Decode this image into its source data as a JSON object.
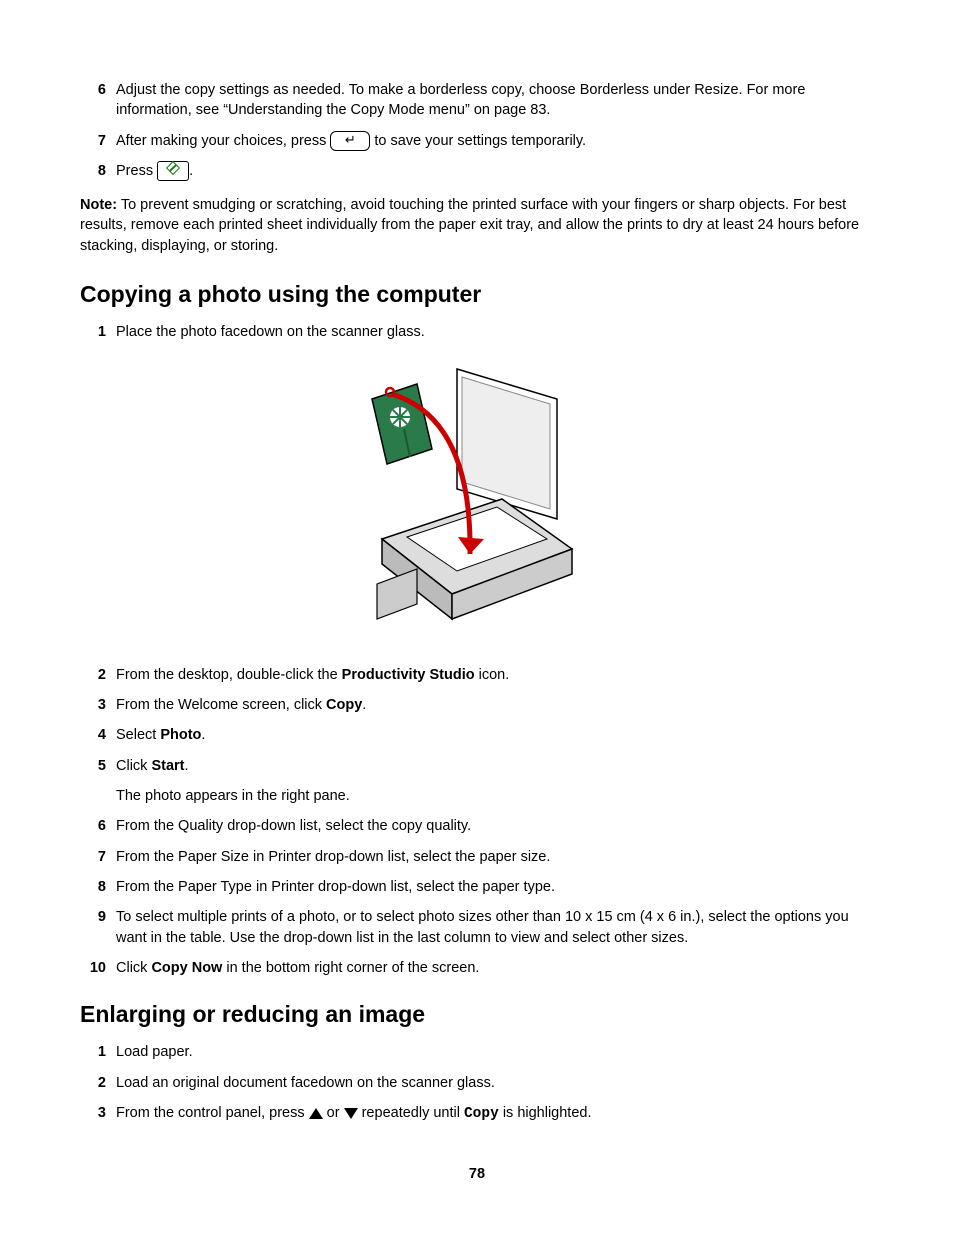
{
  "topSteps": {
    "s6": "Adjust the copy settings as needed. To make a borderless copy, choose Borderless under Resize. For more information, see “Understanding the Copy Mode menu” on page 83.",
    "s7_a": "After making your choices, press ",
    "s7_b": " to save your settings temporarily.",
    "s8_a": "Press ",
    "s8_b": "."
  },
  "note": {
    "label": "Note:",
    "text": " To prevent smudging or scratching, avoid touching the printed surface with your fingers or sharp objects. For best results, remove each printed sheet individually from the paper exit tray, and allow the prints to dry at least 24 hours before stacking, displaying, or storing."
  },
  "heading1": "Copying a photo using the computer",
  "copySteps": {
    "s1": "Place the photo facedown on the scanner glass.",
    "s2_a": "From the desktop, double-click the ",
    "s2_b": "Productivity Studio",
    "s2_c": " icon.",
    "s3_a": "From the Welcome screen, click ",
    "s3_b": "Copy",
    "s3_c": ".",
    "s4_a": "Select ",
    "s4_b": "Photo",
    "s4_c": ".",
    "s5_a": "Click ",
    "s5_b": "Start",
    "s5_c": ".",
    "s5_sub": "The photo appears in the right pane.",
    "s6": "From the Quality drop-down list, select the copy quality.",
    "s7": "From the Paper Size in Printer drop-down list, select the paper size.",
    "s8": "From the Paper Type in Printer drop-down list, select the paper type.",
    "s9": "To select multiple prints of a photo, or to select photo sizes other than 10 x 15 cm (4 x 6 in.), select the options you want in the table. Use the drop-down list in the last column to view and select other sizes.",
    "s10_a": "Click ",
    "s10_b": "Copy Now",
    "s10_c": " in the bottom right corner of the screen."
  },
  "heading2": "Enlarging or reducing an image",
  "enlargeSteps": {
    "s1": "Load paper.",
    "s2": "Load an original document facedown on the scanner glass.",
    "s3_a": "From the control panel, press ",
    "s3_b": " or ",
    "s3_c": " repeatedly until ",
    "s3_d": "Copy",
    "s3_e": " is highlighted."
  },
  "pageNumber": "78"
}
